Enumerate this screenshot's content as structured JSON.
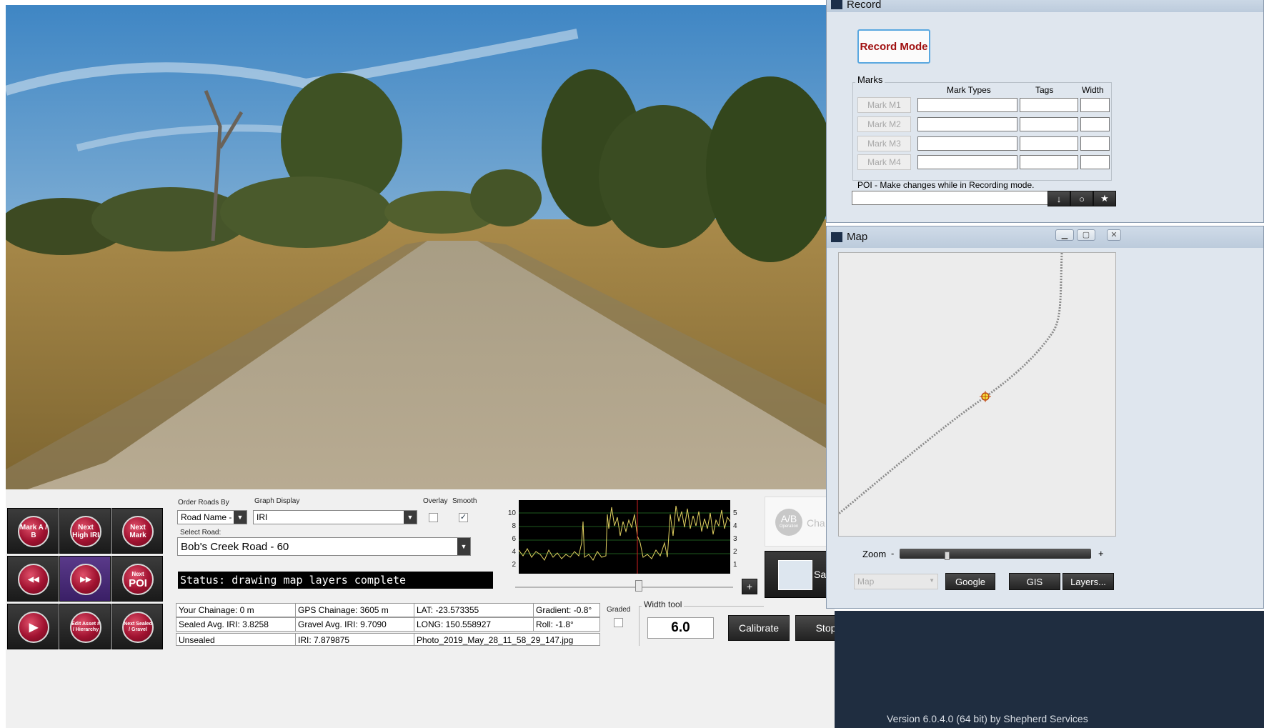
{
  "buttons": {
    "mark_ab": "Mark A / B",
    "next_high_iri": "Next High IRI",
    "next_mark": "Next Mark",
    "rewind": "◀◀",
    "fast_forward": "▶▶",
    "next_poi_small": "Next",
    "next_poi_big": "POI",
    "play": "▶",
    "edit_asset": "Edit Asset # / Hierarchy",
    "next_sealed_gravel": "Next Sealed / Gravel"
  },
  "controls": {
    "order_roads_label": "Order Roads By",
    "order_roads_value": "Road Name - /",
    "graph_display_label": "Graph Display",
    "graph_display_value": "IRI",
    "overlay_label": "Overlay",
    "smooth_label": "Smooth",
    "smooth_checked": "✓",
    "select_road_label": "Select Road:",
    "select_road_value": "Bob's Creek Road - 60",
    "status": "Status: drawing map layers complete",
    "graded_label": "Graded",
    "width_tool_label": "Width tool",
    "width_tool_value": "6.0",
    "calibrate": "Calibrate",
    "stop": "Stop",
    "plus": "+",
    "ab_operation_big": "A/B",
    "ab_operation_small": "Operation",
    "ab_operation_text": "Cha",
    "save_text": "Sa"
  },
  "graph": {
    "left_ticks": [
      "10",
      "8",
      "6",
      "4",
      "2"
    ],
    "right_ticks": [
      "5",
      "4",
      "3",
      "2",
      "1"
    ]
  },
  "info": {
    "your_chainage": "Your Chainage: 0 m",
    "gps_chainage": "GPS Chainage: 3605 m",
    "lat": "LAT: -23.573355",
    "gradient": "Gradient: -0.8°",
    "sealed_avg": "Sealed Avg. IRI: 3.8258",
    "gravel_avg": "Gravel Avg. IRI: 9.7090",
    "long": "LONG: 150.558927",
    "roll": "Roll: -1.8°",
    "surface": "Unsealed",
    "iri": "IRI: 7.879875",
    "photo": "Photo_2019_May_28_11_58_29_147.jpg"
  },
  "record_window": {
    "title": "Record",
    "record_mode": "Record Mode",
    "marks_label": "Marks",
    "col_mark_types": "Mark Types",
    "col_tags": "Tags",
    "col_width": "Width",
    "marks": [
      "Mark M1",
      "Mark M2",
      "Mark M3",
      "Mark M4"
    ],
    "poi_label": "POI - Make changes while in Recording mode.",
    "poi_btn_down": "↓",
    "poi_btn_circle": "○",
    "poi_btn_star": "★"
  },
  "map_window": {
    "title": "Map",
    "zoom_label": "Zoom",
    "zoom_minus": "-",
    "zoom_plus": "+",
    "map_select": "Map",
    "google": "Google",
    "gis": "GIS",
    "layers": "Layers..."
  },
  "version": "Version 6.0.4.0 (64 bit) by Shepherd Services"
}
